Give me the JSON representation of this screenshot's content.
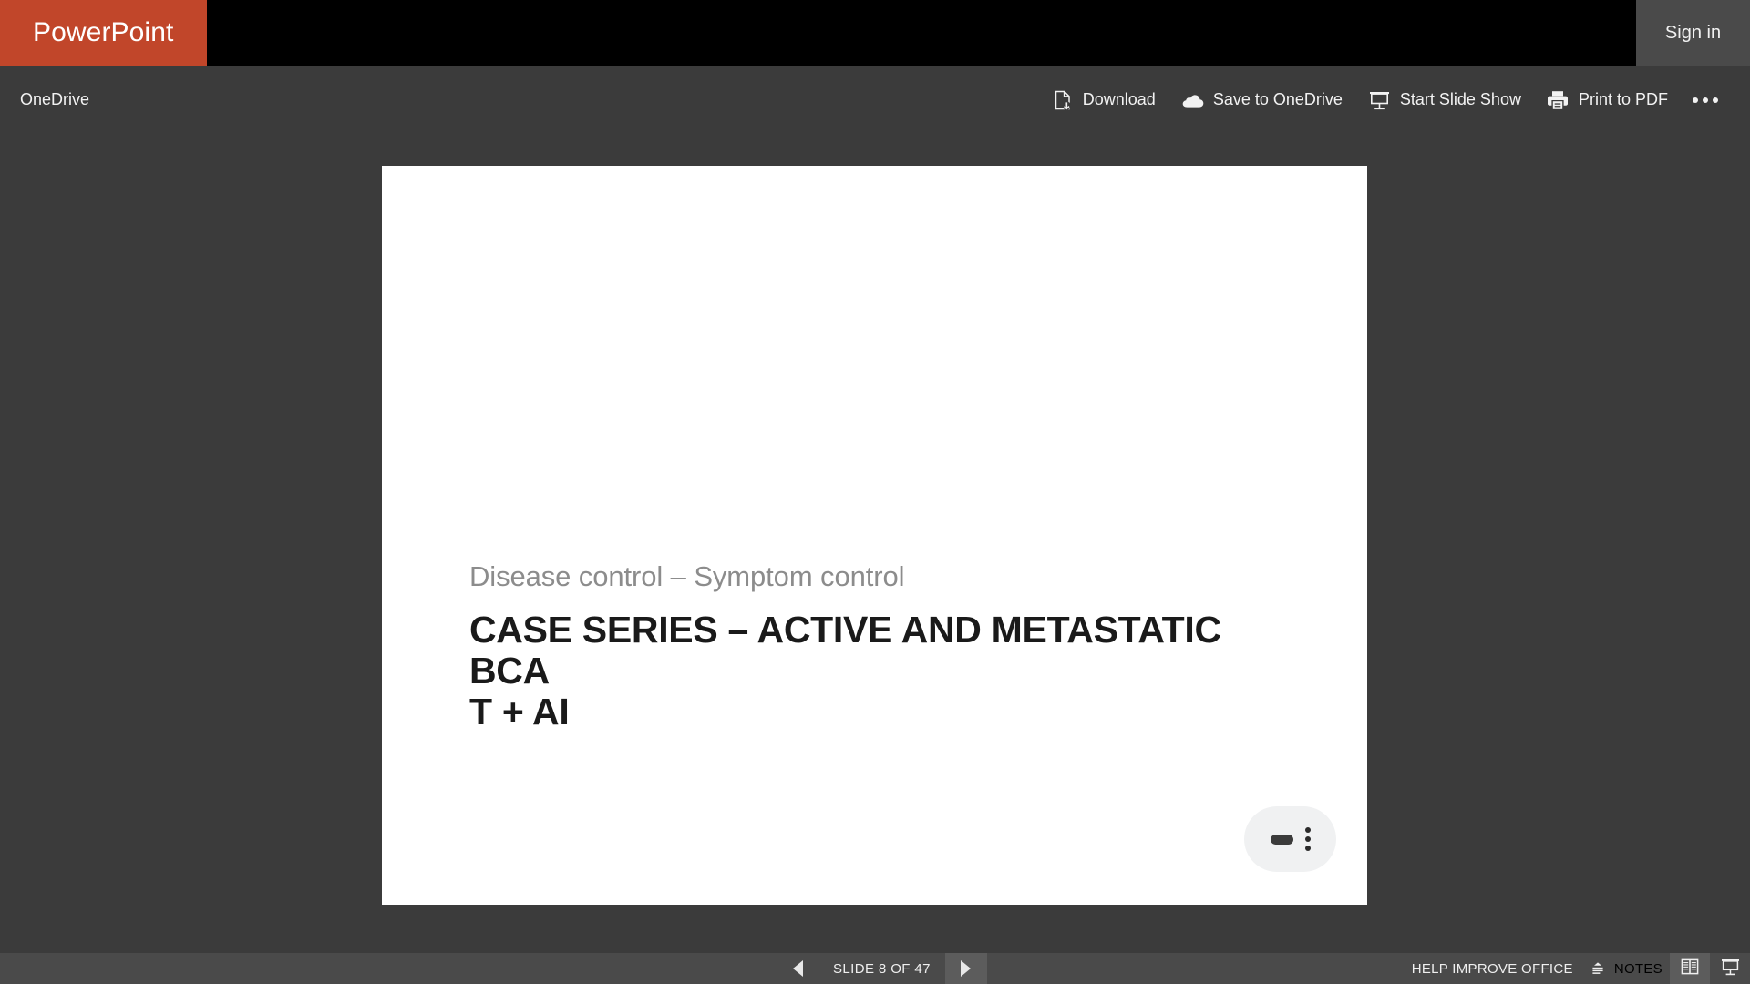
{
  "header": {
    "brand": "PowerPoint",
    "signin_label": "Sign in",
    "brand_color": "#c1462a",
    "bar_color": "#000000"
  },
  "commandbar": {
    "breadcrumb": "OneDrive",
    "commands": [
      {
        "label": "Download",
        "icon": "download-icon"
      },
      {
        "label": "Save to OneDrive",
        "icon": "cloud-icon"
      },
      {
        "label": "Start Slide Show",
        "icon": "slideshow-icon"
      },
      {
        "label": "Print to PDF",
        "icon": "printer-icon"
      }
    ],
    "more_icon": "ellipsis-icon"
  },
  "slide": {
    "subtitle": "Disease control – Symptom control",
    "title": "CASE SERIES – ACTIVE AND METASTATIC BCA\nT + AI",
    "background": "#ffffff",
    "subtitle_color": "#8c8c8c",
    "title_color": "#1a1a1a",
    "floating_control": {
      "dash_icon": "dash-icon",
      "menu_icon": "more-vertical-icon"
    }
  },
  "statusbar": {
    "prev_icon": "previous-slide-icon",
    "next_icon": "next-slide-icon",
    "counter": "SLIDE 8 OF 47",
    "help_improve": "HELP IMPROVE OFFICE",
    "notes_label": "NOTES",
    "notes_icon": "notes-expand-icon",
    "reading_view_icon": "reading-view-icon",
    "slideshow_view_icon": "slideshow-view-icon",
    "background": "#4a4a4a"
  }
}
